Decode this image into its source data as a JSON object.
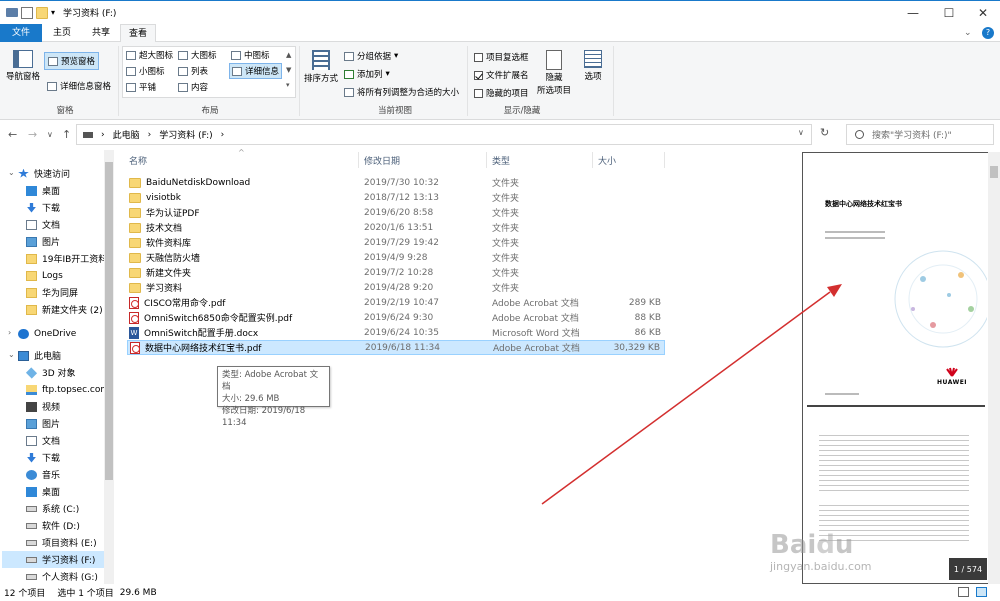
{
  "window": {
    "title": "学习资料 (F:)"
  },
  "ribbon": {
    "tabs": [
      "文件",
      "主页",
      "共享",
      "查看"
    ],
    "active_tab": "查看",
    "panes": {
      "nav_pane": "导航窗格",
      "preview_pane": "预览窗格",
      "details_pane": "详细信息窗格",
      "group": "窗格"
    },
    "layout": {
      "xlarge": "超大图标",
      "large": "大图标",
      "medium": "中图标",
      "small": "小图标",
      "list": "列表",
      "details": "详细信息",
      "tiles": "平铺",
      "content": "内容",
      "group": "布局"
    },
    "current_view": {
      "sort": "排序方式",
      "group_by": "分组依据",
      "add_column": "添加列",
      "fit_columns": "将所有列调整为合适的大小",
      "group": "当前视图"
    },
    "show_hide": {
      "item_checkboxes": "项目复选框",
      "file_ext": "文件扩展名",
      "hidden_items": "隐藏的项目",
      "hide": "隐藏",
      "hide_sub": "所选项目",
      "options": "选项",
      "group": "显示/隐藏"
    }
  },
  "address": {
    "crumbs": [
      "此电脑",
      "学习资料 (F:)"
    ],
    "search_placeholder": "搜索\"学习资料 (F:)\""
  },
  "nav": [
    {
      "label": "快速访问",
      "icon": "star-icon"
    },
    {
      "label": "桌面",
      "icon": "desktop-icon"
    },
    {
      "label": "下载",
      "icon": "download-icon"
    },
    {
      "label": "文档",
      "icon": "documents-icon"
    },
    {
      "label": "图片",
      "icon": "pictures-icon"
    },
    {
      "label": "19年IB开工资料",
      "icon": "folder-icon"
    },
    {
      "label": "Logs",
      "icon": "folder-icon"
    },
    {
      "label": "华为同屏",
      "icon": "folder-icon"
    },
    {
      "label": "新建文件夹 (2)",
      "icon": "folder-icon"
    },
    {
      "label": "OneDrive",
      "icon": "onedrive-icon"
    },
    {
      "label": "此电脑",
      "icon": "computer-icon"
    },
    {
      "label": "3D 对象",
      "icon": "3d-icon"
    },
    {
      "label": "ftp.topsec.com",
      "icon": "network-folder-icon"
    },
    {
      "label": "视频",
      "icon": "video-icon"
    },
    {
      "label": "图片",
      "icon": "pictures-icon"
    },
    {
      "label": "文档",
      "icon": "documents-icon"
    },
    {
      "label": "下载",
      "icon": "download-icon"
    },
    {
      "label": "音乐",
      "icon": "music-icon"
    },
    {
      "label": "桌面",
      "icon": "desktop-icon"
    },
    {
      "label": "系统 (C:)",
      "icon": "drive-icon"
    },
    {
      "label": "软件 (D:)",
      "icon": "drive-icon"
    },
    {
      "label": "项目资料 (E:)",
      "icon": "drive-icon"
    },
    {
      "label": "学习资料 (F:)",
      "icon": "drive-icon"
    },
    {
      "label": "个人资料 (G:)",
      "icon": "drive-icon"
    }
  ],
  "columns": {
    "name": "名称",
    "date": "修改日期",
    "type": "类型",
    "size": "大小"
  },
  "files": [
    {
      "name": "BaiduNetdiskDownload",
      "date": "2019/7/30 10:32",
      "type": "文件夹",
      "size": "",
      "kind": "folder"
    },
    {
      "name": "visiotbk",
      "date": "2018/7/12 13:13",
      "type": "文件夹",
      "size": "",
      "kind": "folder"
    },
    {
      "name": "华为认证PDF",
      "date": "2019/6/20 8:58",
      "type": "文件夹",
      "size": "",
      "kind": "folder"
    },
    {
      "name": "技术文档",
      "date": "2020/1/6 13:51",
      "type": "文件夹",
      "size": "",
      "kind": "folder"
    },
    {
      "name": "软件资料库",
      "date": "2019/7/29 19:42",
      "type": "文件夹",
      "size": "",
      "kind": "folder"
    },
    {
      "name": "天融信防火墙",
      "date": "2019/4/9 9:28",
      "type": "文件夹",
      "size": "",
      "kind": "folder"
    },
    {
      "name": "新建文件夹",
      "date": "2019/7/2 10:28",
      "type": "文件夹",
      "size": "",
      "kind": "folder"
    },
    {
      "name": "学习资料",
      "date": "2019/4/28 9:20",
      "type": "文件夹",
      "size": "",
      "kind": "folder"
    },
    {
      "name": "CISCO常用命令.pdf",
      "date": "2019/2/19 10:47",
      "type": "Adobe Acrobat 文档",
      "size": "289 KB",
      "kind": "pdf"
    },
    {
      "name": "OmniSwitch6850命令配置实例.pdf",
      "date": "2019/6/24 9:30",
      "type": "Adobe Acrobat 文档",
      "size": "88 KB",
      "kind": "pdf"
    },
    {
      "name": "OmniSwitch配置手册.docx",
      "date": "2019/6/24 10:35",
      "type": "Microsoft Word 文档",
      "size": "86 KB",
      "kind": "doc"
    },
    {
      "name": "数据中心网络技术红宝书.pdf",
      "date": "2019/6/18 11:34",
      "type": "Adobe Acrobat 文档",
      "size": "30,329 KB",
      "kind": "pdf"
    }
  ],
  "tooltip": {
    "type": "类型: Adobe Acrobat 文档",
    "size": "大小: 29.6 MB",
    "date": "修改日期: 2019/6/18 11:34"
  },
  "preview": {
    "doc_title": "数据中心网络技术红宝书",
    "brand": "HUAWEI",
    "page_indicator": "1 / 574"
  },
  "status": {
    "count": "12 个项目",
    "selected": "选中 1 个项目",
    "size": "29.6 MB"
  },
  "watermark": {
    "text": "jingyan.baidu.com"
  },
  "colors": {
    "accent": "#1979ca",
    "selection": "#cce8ff",
    "annotation_arrow": "#d32f2f"
  }
}
